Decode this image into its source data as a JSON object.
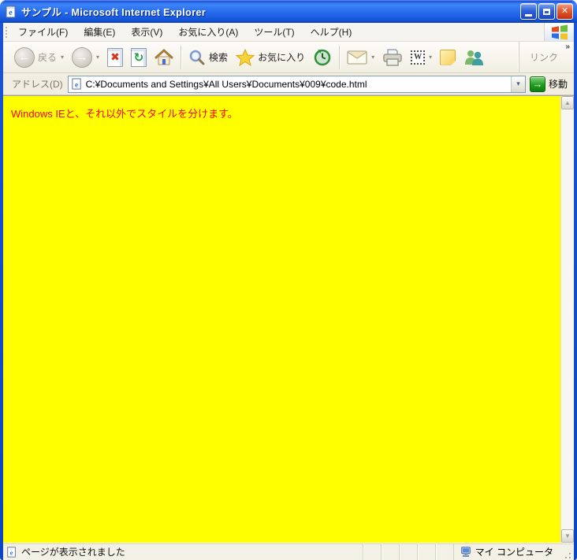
{
  "window": {
    "title": "サンプル - Microsoft Internet Explorer",
    "controls": {
      "minimize": "minimize",
      "maximize": "maximize",
      "close": "close"
    }
  },
  "menubar": {
    "items": [
      {
        "label": "ファイル(F)"
      },
      {
        "label": "編集(E)"
      },
      {
        "label": "表示(V)"
      },
      {
        "label": "お気に入り(A)"
      },
      {
        "label": "ツール(T)"
      },
      {
        "label": "ヘルプ(H)"
      }
    ]
  },
  "toolbar": {
    "back_label": "戻る",
    "search_label": "検索",
    "favorites_label": "お気に入り",
    "links_label": "リンク",
    "links_chevron": "»",
    "edit_glyph": "W",
    "dropdown_glyph": "▾"
  },
  "addressbar": {
    "label": "アドレス(D)",
    "value": "C:¥Documents and Settings¥All Users¥Documents¥009¥code.html",
    "dropdown_glyph": "▾",
    "go_arrow": "→",
    "go_label": "移動"
  },
  "content": {
    "text": "Windows IEと、それ以外でスタイルを分けます。",
    "background_color": "#ffff00",
    "text_color": "#ff0000"
  },
  "scrollbar": {
    "up_glyph": "▲",
    "down_glyph": "▼"
  },
  "statusbar": {
    "left_text": "ページが表示されました",
    "zone_text": "マイ コンピュータ"
  },
  "colors": {
    "titlebar_blue": "#2e74f2",
    "window_border_blue": "#1a54d8",
    "toolbar_bg": "#f1eee1",
    "close_red": "#e25a30"
  }
}
